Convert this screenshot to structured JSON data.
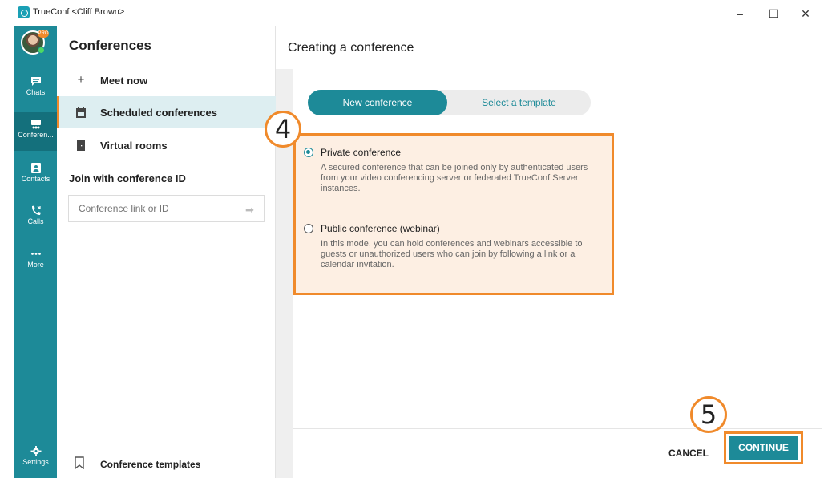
{
  "window": {
    "title": "TrueConf <Cliff Brown>",
    "minimize": "–",
    "maximize": "☐",
    "close": "✕"
  },
  "rail": {
    "badge": "PRO",
    "items": [
      {
        "label": "Chats",
        "icon": "chat-icon"
      },
      {
        "label": "Conferen...",
        "icon": "conference-icon"
      },
      {
        "label": "Contacts",
        "icon": "contacts-icon"
      },
      {
        "label": "Calls",
        "icon": "calls-icon"
      },
      {
        "label": "More",
        "icon": "more-icon"
      },
      {
        "label": "Settings",
        "icon": "gear-icon"
      }
    ]
  },
  "panel": {
    "title": "Conferences",
    "items": [
      {
        "label": "Meet now",
        "icon": "plus-icon"
      },
      {
        "label": "Scheduled conferences",
        "icon": "calendar-icon"
      },
      {
        "label": "Virtual rooms",
        "icon": "door-icon"
      }
    ],
    "join_label": "Join with conference ID",
    "join_placeholder": "Conference link or ID",
    "templates_label": "Conference templates"
  },
  "main": {
    "title": "Creating a conference",
    "tabs": [
      "New conference",
      "Select a template"
    ],
    "options": [
      {
        "title": "Private conference",
        "selected": true,
        "description": "A secured conference that can be joined only by authenticated users from your video conferencing server or federated TrueConf Server instances."
      },
      {
        "title": "Public conference (webinar)",
        "selected": false,
        "description": "In this mode, you can hold conferences and webinars accessible to guests or unauthorized users who can join by following a link or a calendar invitation."
      }
    ],
    "cancel": "CANCEL",
    "continue": "CONTINUE"
  },
  "callouts": {
    "step4": "4",
    "step5": "5"
  },
  "colors": {
    "accent": "#1d8a98",
    "highlight": "#f08a2b"
  }
}
